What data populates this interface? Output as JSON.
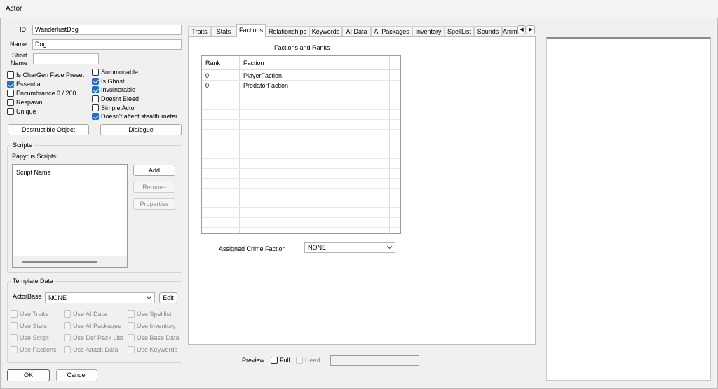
{
  "window": {
    "title": "Actor"
  },
  "fields": {
    "id_label": "ID",
    "id_value": "WanderlustDog",
    "name_label": "Name",
    "name_value": "Dog",
    "short_label_1": "Short",
    "short_label_2": "Name",
    "short_value": ""
  },
  "checkboxes_left": [
    {
      "label": "Is CharGen Face Preset",
      "checked": false
    },
    {
      "label": "Essential",
      "checked": true
    },
    {
      "label": "Encumbrance 0 / 200",
      "checked": false
    },
    {
      "label": "Respawn",
      "checked": false
    },
    {
      "label": "Unique",
      "checked": false
    }
  ],
  "checkboxes_right": [
    {
      "label": "Summonable",
      "checked": false
    },
    {
      "label": "Is Ghost",
      "checked": true
    },
    {
      "label": "Invulnerable",
      "checked": true
    },
    {
      "label": "Doesnt Bleed",
      "checked": false
    },
    {
      "label": "Simple Actor",
      "checked": false
    },
    {
      "label": "Doesn't affect stealth meter",
      "checked": true
    }
  ],
  "buttons": {
    "destructible": "Destructible Object",
    "dialogue": "Dialogue",
    "ok": "OK",
    "cancel": "Cancel"
  },
  "scripts": {
    "group_label": "Scripts",
    "papyrus_label": "Papyrus Scripts:",
    "column": "Script Name",
    "add": "Add",
    "remove": "Remove",
    "properties": "Properties"
  },
  "template": {
    "group_label": "Template Data",
    "actorbase_label": "ActorBase",
    "actorbase_value": "NONE",
    "edit": "Edit",
    "options": [
      [
        "Use Traits",
        "Use AI Data",
        "Use Spelllist"
      ],
      [
        "Use Stats",
        "Use AI Packages",
        "Use Inventory"
      ],
      [
        "Use Script",
        "Use Def Pack List",
        "Use Base Data"
      ],
      [
        "Use Factions",
        "Use Attack Data",
        "Use Keywords"
      ]
    ]
  },
  "tabs": [
    "Traits",
    "Stats",
    "Factions",
    "Relationships",
    "Keywords",
    "AI Data",
    "AI Packages",
    "Inventory",
    "SpellList",
    "Sounds",
    "Anim"
  ],
  "selected_tab": "Factions",
  "factions": {
    "title": "Factions and Ranks",
    "col_rank": "Rank",
    "col_faction": "Faction",
    "rows": [
      {
        "rank": "0",
        "faction": "PlayerFaction"
      },
      {
        "rank": "0",
        "faction": "PredatorFaction"
      }
    ],
    "crime_label": "Assigned Crime Faction",
    "crime_value": "NONE"
  },
  "preview": {
    "label": "Preview",
    "full": "Full",
    "head": "Head"
  }
}
